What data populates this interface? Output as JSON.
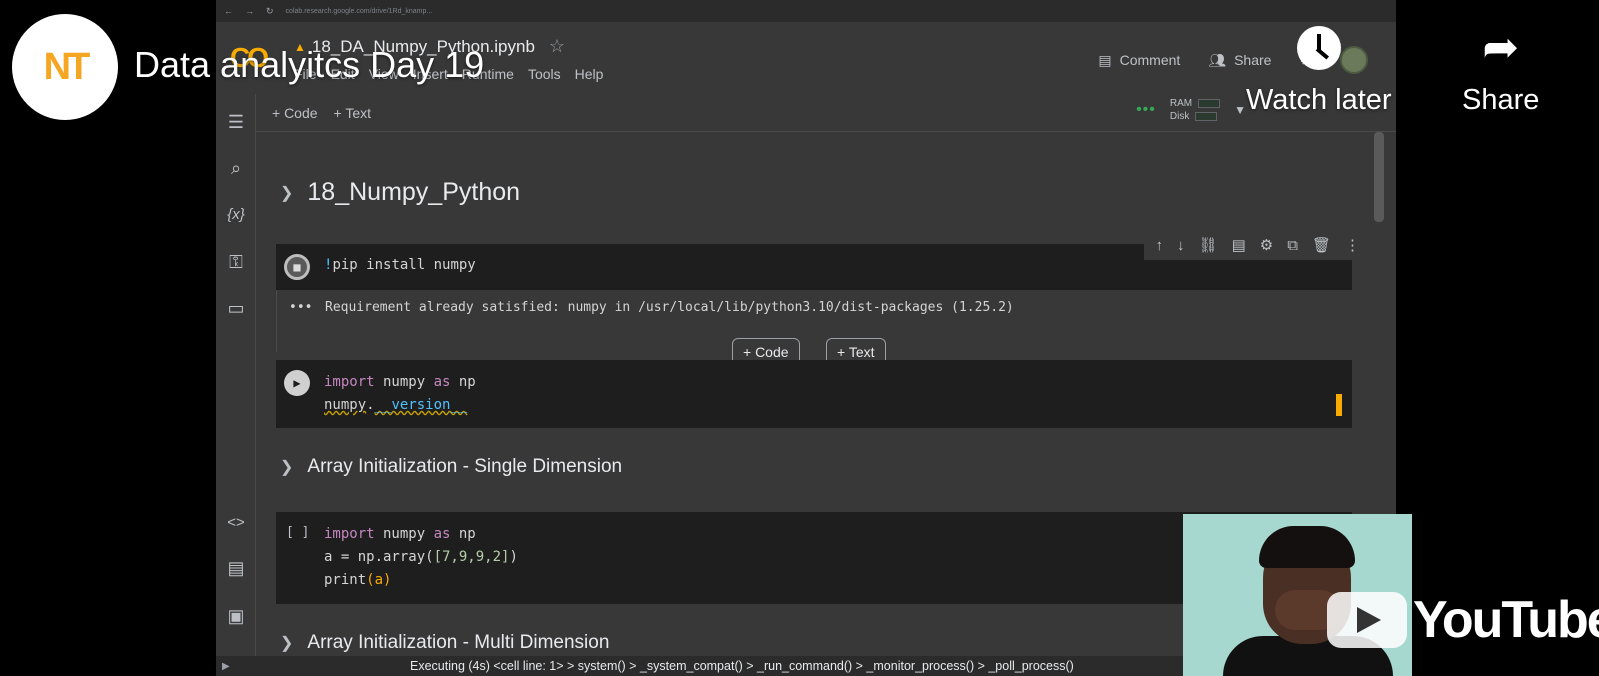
{
  "browser": {
    "url": "colab.research.google.com/drive/1Rd_knamp..."
  },
  "colab": {
    "notebook_title": "18_DA_Numpy_Python.ipynb",
    "menu": [
      "File",
      "Edit",
      "View",
      "Insert",
      "Runtime",
      "Tools",
      "Help"
    ],
    "comment_label": "Comment",
    "share_label": "Share",
    "toolbar": {
      "add_code": "+ Code",
      "add_text": "+ Text",
      "ram_label": "RAM",
      "disk_label": "Disk"
    },
    "section1": "18_Numpy_Python",
    "cell1": {
      "bang": "!",
      "code": "pip install numpy",
      "output_marker": "•••",
      "output": "Requirement already satisfied: numpy in /usr/local/lib/python3.10/dist-packages (1.25.2)"
    },
    "insert_code": "+ Code",
    "insert_text": "+ Text",
    "cell2": {
      "l1_kw1": "import",
      "l1_mod": " numpy ",
      "l1_kw2": "as",
      "l1_alias": " np",
      "l2_obj": "numpy",
      "l2_dot": ".",
      "l2_attr": "__version__"
    },
    "section2": "Array Initialization - Single Dimension",
    "cell3": {
      "prompt": "[ ]",
      "l1_kw1": "import",
      "l1_mod": " numpy ",
      "l1_kw2": "as",
      "l1_alias": " np",
      "l2_pre": "a = np.array(",
      "l2_args": "[7,9,9,2]",
      "l2_post": ")",
      "l3_pre": "print",
      "l3_args": "(a)"
    },
    "section3_partial": "Array Initialization - Multi Dimension",
    "status": "Executing (4s)   <cell line: 1> > system() > _system_compat() > _run_command() > _monitor_process() > _poll_process()"
  },
  "youtube": {
    "channel_logo": "NT",
    "video_title": "Data analyitcs Day 19",
    "watch_later": "Watch later",
    "share": "Share",
    "watermark": "YouTube"
  }
}
